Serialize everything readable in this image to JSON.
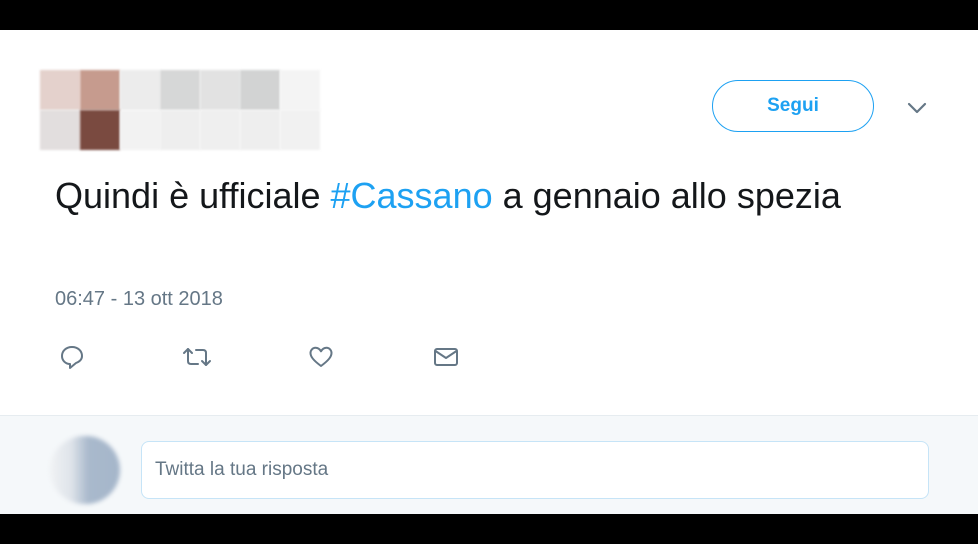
{
  "tweet": {
    "text_before": "Quindi è ufficiale ",
    "hashtag": "#Cassano",
    "text_after": " a gennaio allo spezia",
    "timestamp": "06:47 - 13 ott 2018"
  },
  "header": {
    "follow_label": "Segui",
    "menu_icon": "chevron-down-icon"
  },
  "actions": [
    {
      "name": "reply",
      "icon": "reply-icon"
    },
    {
      "name": "retweet",
      "icon": "retweet-icon"
    },
    {
      "name": "like",
      "icon": "heart-icon"
    },
    {
      "name": "direct-message",
      "icon": "mail-icon"
    }
  ],
  "reply_box": {
    "placeholder": "Twitta la tua risposta"
  },
  "colors": {
    "accent": "#1da1f2",
    "text": "#14171a",
    "muted": "#657786"
  }
}
